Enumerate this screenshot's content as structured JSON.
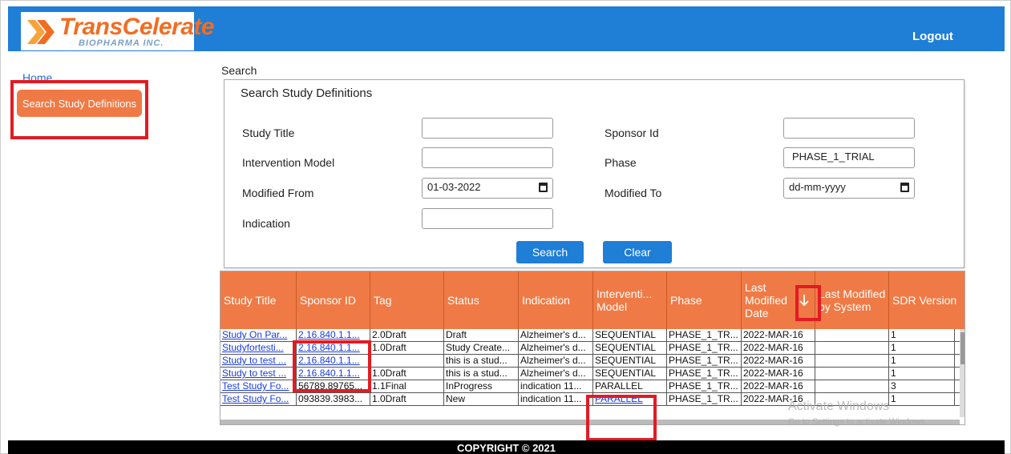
{
  "header": {
    "logo_main": "TransCelerate",
    "logo_sub": "BIOPHARMA INC.",
    "logout_label": "Logout",
    "color": "#1f7ed6"
  },
  "sidebar": {
    "home_label": "Home",
    "search_label": "Search Study Definitions"
  },
  "breadcrumb": "Search",
  "search": {
    "title": "Search Study Definitions",
    "study_title_label": "Study Title",
    "study_title_value": "",
    "intervention_model_label": "Intervention Model",
    "intervention_model_value": "",
    "modified_from_label": "Modified From",
    "modified_from_value": "01-03-2022",
    "indication_label": "Indication",
    "indication_value": "",
    "sponsor_id_label": "Sponsor Id",
    "sponsor_id_value": "",
    "phase_label": "Phase",
    "phase_value": "PHASE_1_TRIAL",
    "modified_to_label": "Modified To",
    "modified_to_placeholder": "dd-mm-yyyy",
    "search_button": "Search",
    "clear_button": "Clear"
  },
  "table": {
    "columns": [
      "Study Title",
      "Sponsor ID",
      "Tag",
      "Status",
      "Indication",
      "Interventi... Model",
      "Phase",
      "Last Modified Date",
      "Last Modified by System",
      "SDR Version"
    ],
    "sort_icon": "arrow-down-icon",
    "rows": [
      [
        "Study On Par...",
        "2.16.840.1.1...",
        "2.0Draft",
        "Draft",
        "Alzheimer's d...",
        "SEQUENTIAL",
        "PHASE_1_TR...",
        "2022-MAR-16",
        "",
        "1"
      ],
      [
        "Studyfortesti...",
        "2.16.840.1.1...",
        "1.0Draft",
        "Study Create...",
        "Alzheimer's d...",
        "SEQUENTIAL",
        "PHASE_1_TR...",
        "2022-MAR-16",
        "",
        "1"
      ],
      [
        "Study to test ...",
        "2.16.840.1.1...",
        "",
        "this is a stud...",
        "Alzheimer's d...",
        "SEQUENTIAL",
        "PHASE_1_TR...",
        "2022-MAR-16",
        "",
        "1"
      ],
      [
        "Study to test ...",
        "2.16.840.1.1...",
        "1.0Draft",
        "this is a stud...",
        "Alzheimer's d...",
        "SEQUENTIAL",
        "PHASE_1_TR...",
        "2022-MAR-16",
        "",
        "1"
      ],
      [
        "Test Study Fo...",
        "56789.89765...",
        "1.1Final",
        "InProgress",
        "indication 11...",
        "PARALLEL",
        "PHASE_1_TR...",
        "2022-MAR-16",
        "",
        "3"
      ],
      [
        "Test Study Fo...",
        "093839.3983...",
        "1.0Draft",
        "New",
        "indication 11...",
        "PARALLEL",
        "PHASE_1_TR...",
        "2022-MAR-16",
        "",
        "1"
      ]
    ]
  },
  "watermark": {
    "line1": "Activate Windows",
    "line2": "Go to Settings to activate Windows."
  },
  "footer": "COPYRIGHT © 2021"
}
